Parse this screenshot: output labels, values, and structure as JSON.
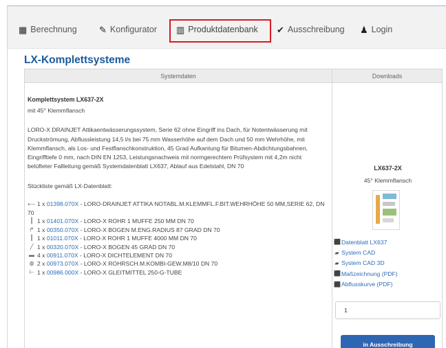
{
  "navbar": {
    "items": [
      {
        "label": "Berechnung",
        "icon": "calculator-icon",
        "glyph": "▦"
      },
      {
        "label": "Konfigurator",
        "icon": "wrench-icon",
        "glyph": "✎"
      },
      {
        "label": "Produktdatenbank",
        "icon": "barcode-icon",
        "glyph": "▥"
      },
      {
        "label": "Ausschreibung",
        "icon": "check-icon",
        "glyph": "✔"
      },
      {
        "label": "Login",
        "icon": "user-icon",
        "glyph": "♟"
      }
    ],
    "active": "Produktdatenbank",
    "highlight_color": "#d71920"
  },
  "page": {
    "title": "LX-Komplettsysteme"
  },
  "table": {
    "headers": {
      "systemdaten": "Systemdaten",
      "downloads": "Downloads"
    }
  },
  "system": {
    "heading": "Komplettsystem LX637-2X",
    "subheading": "mit 45° Klemmflansch",
    "description": "LORO-X DRAINJET Attikaentwässerungssystem, Serie 62 ohne Eingriff ins Dach, für Notentwässerung mit Druckströmung, Abflussleistung 14,5 l/s bei 75 mm Wasserhöhe auf dem Dach und 50 mm Wehrhöhe, mit Klemmflansch, als Los- und Festflanschkonstruktion, 45 Grad Aufkantung für Bitumen-Abdichtungsbahnen, Eingrifftiefe 0 mm, nach DIN EN 1253, Leistungsnachweis mit normgerechtem Prüfsystem mit 4,2m nicht belüfteter Fallleitung gemäß Systemdatenblatt LX637, Ablauf aus Edelstahl, DN 70",
    "list_title": "Stückliste gemäß LX-Datenblatt:",
    "parts": [
      {
        "icon": "attika-part-icon",
        "glyph": "⟵",
        "qty": "1 x",
        "code": "01398.070X",
        "text": "- LORO-DRAINJET ATTIKA NOTABL.M.KLEMMFL.F.BIT.WEHRHÖHE 50 MM,SERIE 62, DN 70",
        "wrap": true
      },
      {
        "icon": "pipe-part-icon",
        "glyph": "┃",
        "qty": "1 x",
        "code": "01401.070X",
        "text": "- LORO-X ROHR 1 MUFFE 250 MM DN 70",
        "wrap": false
      },
      {
        "icon": "bend-part-icon",
        "glyph": "↱",
        "qty": "1 x",
        "code": "00350.070X",
        "text": "- LORO-X BOGEN M.ENG.RADIUS 87 GRAD DN 70",
        "wrap": false
      },
      {
        "icon": "pipe-part-icon",
        "glyph": "┃",
        "qty": "1 x",
        "code": "01011.070X",
        "text": "- LORO-X ROHR 1 MUFFE 4000 MM DN 70",
        "wrap": false
      },
      {
        "icon": "bend45-part-icon",
        "glyph": "╱",
        "qty": "1 x",
        "code": "00320.070X",
        "text": "- LORO-X BOGEN 45 GRAD DN 70",
        "wrap": false
      },
      {
        "icon": "seal-part-icon",
        "glyph": "▬",
        "qty": "4 x",
        "code": "00911.070X",
        "text": "- LORO-X DICHTELEMENT DN 70",
        "wrap": false
      },
      {
        "icon": "clamp-part-icon",
        "glyph": "◍",
        "qty": "2 x",
        "code": "00973.070X",
        "text": "- LORO-X ROHRSCH.M.KOMBI-GEW.M8/10 DN 70",
        "wrap": false
      },
      {
        "icon": "lubricant-part-icon",
        "glyph": "⊢",
        "qty": "1 x",
        "code": "00986.000X",
        "text": "- LORO-X GLEITMITTEL 250-G-TUBE",
        "wrap": false
      }
    ]
  },
  "downloads": {
    "product": "LX637-2X",
    "product_sub": "45° Klemmflansch",
    "links": [
      {
        "label": "Datenblatt LX637",
        "icon": "pdf-icon",
        "glyph": "⬛",
        "kind": "pdf"
      },
      {
        "label": "System CAD",
        "icon": "cad-icon",
        "glyph": "▰",
        "kind": "cad"
      },
      {
        "label": "System CAD 3D",
        "icon": "cad-3d-icon",
        "glyph": "▰",
        "kind": "cad"
      },
      {
        "label": "Maßzeichnung (PDF)",
        "icon": "pdf-icon",
        "glyph": "⬛",
        "kind": "pdf"
      },
      {
        "label": "Abflusskurve (PDF)",
        "icon": "pdf-icon",
        "glyph": "⬛",
        "kind": "pdf"
      }
    ],
    "quantity_value": "1",
    "button_label": "in Ausschreibung",
    "button_color": "#2f66b3"
  }
}
